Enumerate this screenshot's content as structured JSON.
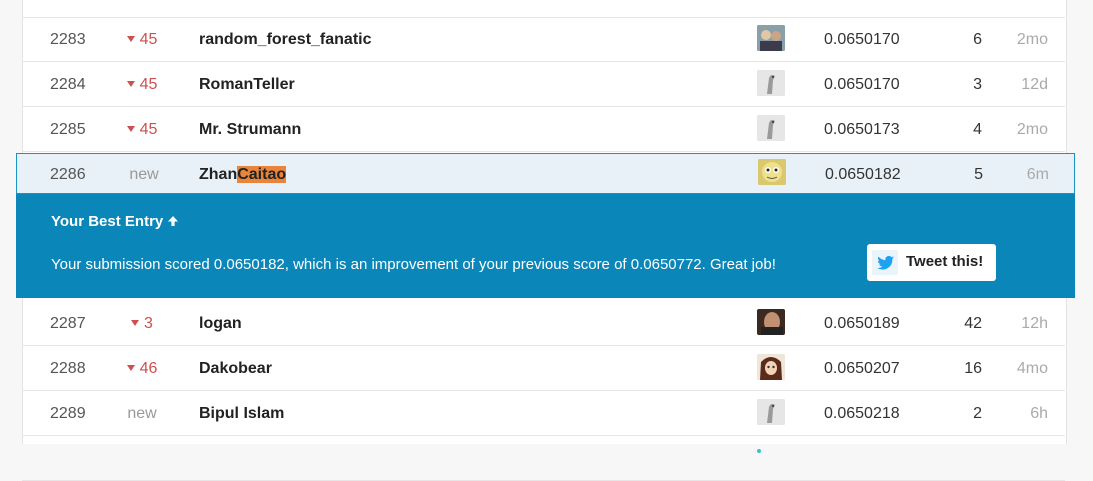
{
  "leaderboard": {
    "rows": [
      {
        "rank": "2283",
        "change": "45",
        "name": "random_forest_fanatic",
        "score": "0.0650170",
        "entries": "6",
        "last": "2mo",
        "avatar_tone": "#5b6a7a",
        "dots": [
          "#9b59b6",
          "#9b59b6",
          "#9b59b6"
        ]
      },
      {
        "rank": "2284",
        "change": "45",
        "name": "RomanTeller",
        "score": "0.0650170",
        "entries": "3",
        "last": "12d",
        "avatar_tone": "#dcdcdc",
        "dots": [
          "#9b59b6",
          "#9b59b6",
          "#9b59b6"
        ]
      },
      {
        "rank": "2285",
        "change": "45",
        "name": "Mr. Strumann",
        "score": "0.0650173",
        "entries": "4",
        "last": "2mo",
        "avatar_tone": "#dcdcdc",
        "dots": [
          "#20b2d8",
          "#20b2d8"
        ]
      },
      {
        "rank": "2287",
        "change": "3",
        "name": "logan",
        "score": "0.0650189",
        "entries": "42",
        "last": "12h",
        "avatar_tone": "#6a4a36",
        "dots": [
          "#3cc0c8"
        ]
      },
      {
        "rank": "2288",
        "change": "46",
        "name": "Dakobear",
        "score": "0.0650207",
        "entries": "16",
        "last": "4mo",
        "avatar_tone": "#5a2a1a",
        "dots": [
          "#20b2d8",
          "#20b2d8"
        ]
      },
      {
        "rank": "2289",
        "change": "new",
        "name": "Bipul Islam",
        "score": "0.0650218",
        "entries": "2",
        "last": "6h",
        "avatar_tone": "#dcdcdc",
        "dots": [
          "#3cc0c8"
        ]
      }
    ],
    "me": {
      "rank": "2286",
      "change": "new",
      "name_prefix": "Zhan",
      "name_highlight": "Caitao",
      "score": "0.0650182",
      "entries": "5",
      "last": "6m",
      "avatar_tone": "#e9d77a",
      "dots": [
        "#3cc0c8"
      ]
    }
  },
  "banner": {
    "title": "Your Best Entry",
    "message": "Your submission scored 0.0650182, which is an improvement of your previous score of 0.0650772. Great job!",
    "tweet_label": "Tweet this!"
  },
  "colors": {
    "accent": "#0a86b8",
    "highlight": "#e8853a",
    "decline": "#cc5050"
  }
}
